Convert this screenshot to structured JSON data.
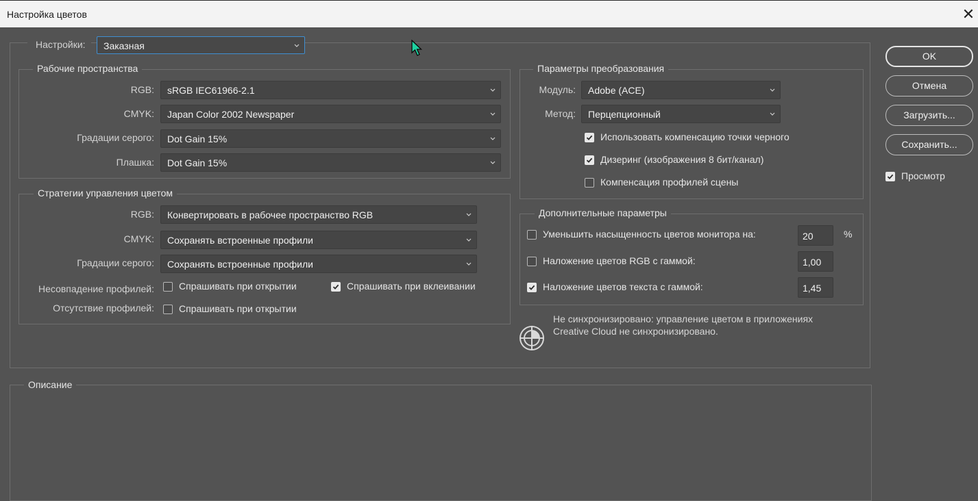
{
  "window": {
    "title": "Настройка цветов",
    "close_label": "✕"
  },
  "settings": {
    "label": "Настройки:",
    "value": "Заказная"
  },
  "working_spaces": {
    "title": "Рабочие пространства",
    "rgb_label": "RGB:",
    "rgb_value": "sRGB IEC61966-2.1",
    "cmyk_label": "CMYK:",
    "cmyk_value": "Japan Color 2002 Newspaper",
    "gray_label": "Градации серого:",
    "gray_value": "Dot Gain 15%",
    "spot_label": "Плашка:",
    "spot_value": "Dot Gain 15%"
  },
  "policies": {
    "title": "Стратегии управления цветом",
    "rgb_label": "RGB:",
    "rgb_value": "Конвертировать в рабочее пространство RGB",
    "cmyk_label": "CMYK:",
    "cmyk_value": "Сохранять встроенные профили",
    "gray_label": "Градации серого:",
    "gray_value": "Сохранять встроенные профили",
    "mismatch_label": "Несовпадение профилей:",
    "mismatch_open_label": "Спрашивать при открытии",
    "mismatch_open_checked": false,
    "mismatch_paste_label": "Спрашивать при вклеивании",
    "mismatch_paste_checked": true,
    "missing_label": "Отсутствие профилей:",
    "missing_open_label": "Спрашивать при открытии",
    "missing_open_checked": false
  },
  "conversion": {
    "title": "Параметры преобразования",
    "engine_label": "Модуль:",
    "engine_value": "Adobe (ACE)",
    "intent_label": "Метод:",
    "intent_value": "Перцепционный",
    "bpc_label": "Использовать компенсацию точки черного",
    "bpc_checked": true,
    "dither_label": "Дизеринг (изображения 8 бит/канал)",
    "dither_checked": true,
    "scene_label": "Компенсация профилей сцены",
    "scene_checked": false
  },
  "advanced": {
    "title": "Дополнительные параметры",
    "desaturate_label": "Уменьшить насыщенность цветов монитора на:",
    "desaturate_checked": false,
    "desaturate_value": "20",
    "desaturate_unit": "%",
    "blend_rgb_label": "Наложение цветов RGB с гаммой:",
    "blend_rgb_checked": false,
    "blend_rgb_value": "1,00",
    "blend_text_label": "Наложение цветов текста с гаммой:",
    "blend_text_checked": true,
    "blend_text_value": "1,45"
  },
  "sync": {
    "line1": "Не синхронизировано: управление цветом в приложениях",
    "line2": "Creative Cloud не синхронизировано.",
    "icon": "color-sync-icon"
  },
  "description": {
    "title": "Описание"
  },
  "buttons": {
    "ok": "OK",
    "cancel": "Отмена",
    "load": "Загрузить...",
    "save": "Сохранить..."
  },
  "preview": {
    "label": "Просмотр",
    "checked": true
  },
  "colors": {
    "background": "#535353",
    "focus": "#3f8fd2",
    "cursor": "#1fd1a0"
  }
}
